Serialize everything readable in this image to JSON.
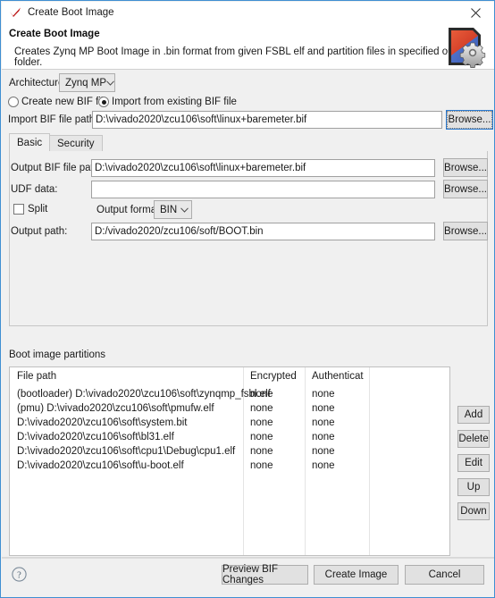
{
  "window": {
    "title": "Create Boot Image",
    "app_icon": "xilinx-check-icon",
    "close_label": "✕"
  },
  "header": {
    "title": "Create Boot Image",
    "description": "Creates Zynq MP Boot Image in .bin format from given FSBL elf and partition files in specified output folder.",
    "logo": "boot-image-gear-icon"
  },
  "form": {
    "architecture_label": "Architecture:",
    "architecture_value": "Zynq MP",
    "radio_create_new": "Create new BIF file",
    "radio_import_existing": "Import from existing BIF file",
    "radio_selected": "import",
    "import_bif_label": "Import BIF file path:",
    "import_bif_value": "D:\\vivado2020\\zcu106\\soft\\linux+baremeter.bif",
    "import_browse_label": "Browse...",
    "output_bif_label": "Output BIF file path:",
    "output_bif_value": "D:\\vivado2020\\zcu106\\soft\\linux+baremeter.bif",
    "output_bif_browse_label": "Browse...",
    "udf_label": "UDF data:",
    "udf_value": "",
    "udf_placeholder": "",
    "udf_browse_label": "Browse...",
    "split_label": "Split",
    "split_checked": false,
    "output_format_label": "Output format:",
    "output_format_value": "BIN",
    "output_path_label": "Output path:",
    "output_path_value": "D:/vivado2020/zcu106/soft/BOOT.bin",
    "output_path_browse_label": "Browse..."
  },
  "tabs": [
    {
      "label": "Basic",
      "active": true
    },
    {
      "label": "Security",
      "active": false
    }
  ],
  "partitions": {
    "section_label": "Boot image partitions",
    "columns": [
      "File path",
      "Encrypted",
      "Authenticat"
    ],
    "rows": [
      {
        "file_path": "(bootloader) D:\\vivado2020\\zcu106\\soft\\zynqmp_fsbl.elf",
        "encrypted": "none",
        "authenticated": "none"
      },
      {
        "file_path": "(pmu) D:\\vivado2020\\zcu106\\soft\\pmufw.elf",
        "encrypted": "none",
        "authenticated": "none"
      },
      {
        "file_path": "D:\\vivado2020\\zcu106\\soft\\system.bit",
        "encrypted": "none",
        "authenticated": "none"
      },
      {
        "file_path": "D:\\vivado2020\\zcu106\\soft\\bl31.elf",
        "encrypted": "none",
        "authenticated": "none"
      },
      {
        "file_path": "D:\\vivado2020\\zcu106\\soft\\cpu1\\Debug\\cpu1.elf",
        "encrypted": "none",
        "authenticated": "none"
      },
      {
        "file_path": "D:\\vivado2020\\zcu106\\soft\\u-boot.elf",
        "encrypted": "none",
        "authenticated": "none"
      }
    ],
    "side_buttons": [
      "Add",
      "Delete",
      "Edit",
      "Up",
      "Down"
    ]
  },
  "footer": {
    "help_icon": "question-mark-icon",
    "preview_label": "Preview BIF Changes",
    "create_label": "Create Image",
    "cancel_label": "Cancel"
  },
  "colors": {
    "dialog_border": "#3f8fd2",
    "panel_bg": "#f0f0f0",
    "field_bg": "#ffffff",
    "button_bg": "#e1e1e1",
    "focus_border": "#2b7cd3"
  }
}
